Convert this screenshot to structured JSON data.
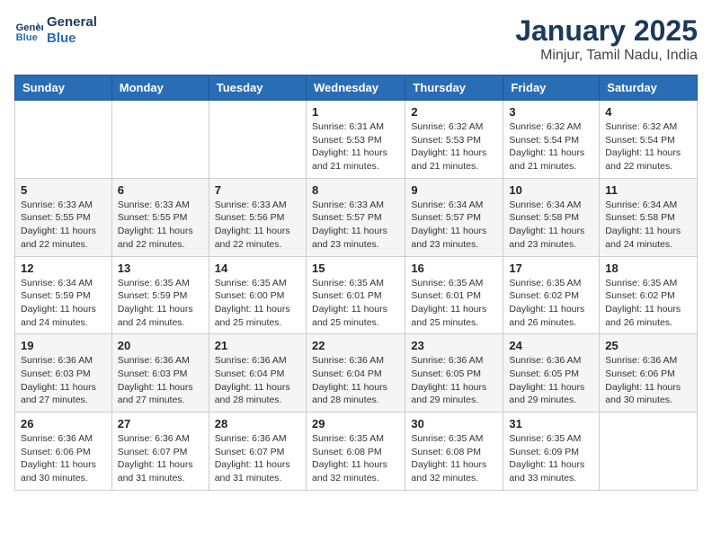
{
  "header": {
    "logo_general": "General",
    "logo_blue": "Blue",
    "month_title": "January 2025",
    "subtitle": "Minjur, Tamil Nadu, India"
  },
  "days_of_week": [
    "Sunday",
    "Monday",
    "Tuesday",
    "Wednesday",
    "Thursday",
    "Friday",
    "Saturday"
  ],
  "weeks": [
    [
      {
        "day": "",
        "info": ""
      },
      {
        "day": "",
        "info": ""
      },
      {
        "day": "",
        "info": ""
      },
      {
        "day": "1",
        "info": "Sunrise: 6:31 AM\nSunset: 5:53 PM\nDaylight: 11 hours and 21 minutes."
      },
      {
        "day": "2",
        "info": "Sunrise: 6:32 AM\nSunset: 5:53 PM\nDaylight: 11 hours and 21 minutes."
      },
      {
        "day": "3",
        "info": "Sunrise: 6:32 AM\nSunset: 5:54 PM\nDaylight: 11 hours and 21 minutes."
      },
      {
        "day": "4",
        "info": "Sunrise: 6:32 AM\nSunset: 5:54 PM\nDaylight: 11 hours and 22 minutes."
      }
    ],
    [
      {
        "day": "5",
        "info": "Sunrise: 6:33 AM\nSunset: 5:55 PM\nDaylight: 11 hours and 22 minutes."
      },
      {
        "day": "6",
        "info": "Sunrise: 6:33 AM\nSunset: 5:55 PM\nDaylight: 11 hours and 22 minutes."
      },
      {
        "day": "7",
        "info": "Sunrise: 6:33 AM\nSunset: 5:56 PM\nDaylight: 11 hours and 22 minutes."
      },
      {
        "day": "8",
        "info": "Sunrise: 6:33 AM\nSunset: 5:57 PM\nDaylight: 11 hours and 23 minutes."
      },
      {
        "day": "9",
        "info": "Sunrise: 6:34 AM\nSunset: 5:57 PM\nDaylight: 11 hours and 23 minutes."
      },
      {
        "day": "10",
        "info": "Sunrise: 6:34 AM\nSunset: 5:58 PM\nDaylight: 11 hours and 23 minutes."
      },
      {
        "day": "11",
        "info": "Sunrise: 6:34 AM\nSunset: 5:58 PM\nDaylight: 11 hours and 24 minutes."
      }
    ],
    [
      {
        "day": "12",
        "info": "Sunrise: 6:34 AM\nSunset: 5:59 PM\nDaylight: 11 hours and 24 minutes."
      },
      {
        "day": "13",
        "info": "Sunrise: 6:35 AM\nSunset: 5:59 PM\nDaylight: 11 hours and 24 minutes."
      },
      {
        "day": "14",
        "info": "Sunrise: 6:35 AM\nSunset: 6:00 PM\nDaylight: 11 hours and 25 minutes."
      },
      {
        "day": "15",
        "info": "Sunrise: 6:35 AM\nSunset: 6:01 PM\nDaylight: 11 hours and 25 minutes."
      },
      {
        "day": "16",
        "info": "Sunrise: 6:35 AM\nSunset: 6:01 PM\nDaylight: 11 hours and 25 minutes."
      },
      {
        "day": "17",
        "info": "Sunrise: 6:35 AM\nSunset: 6:02 PM\nDaylight: 11 hours and 26 minutes."
      },
      {
        "day": "18",
        "info": "Sunrise: 6:35 AM\nSunset: 6:02 PM\nDaylight: 11 hours and 26 minutes."
      }
    ],
    [
      {
        "day": "19",
        "info": "Sunrise: 6:36 AM\nSunset: 6:03 PM\nDaylight: 11 hours and 27 minutes."
      },
      {
        "day": "20",
        "info": "Sunrise: 6:36 AM\nSunset: 6:03 PM\nDaylight: 11 hours and 27 minutes."
      },
      {
        "day": "21",
        "info": "Sunrise: 6:36 AM\nSunset: 6:04 PM\nDaylight: 11 hours and 28 minutes."
      },
      {
        "day": "22",
        "info": "Sunrise: 6:36 AM\nSunset: 6:04 PM\nDaylight: 11 hours and 28 minutes."
      },
      {
        "day": "23",
        "info": "Sunrise: 6:36 AM\nSunset: 6:05 PM\nDaylight: 11 hours and 29 minutes."
      },
      {
        "day": "24",
        "info": "Sunrise: 6:36 AM\nSunset: 6:05 PM\nDaylight: 11 hours and 29 minutes."
      },
      {
        "day": "25",
        "info": "Sunrise: 6:36 AM\nSunset: 6:06 PM\nDaylight: 11 hours and 30 minutes."
      }
    ],
    [
      {
        "day": "26",
        "info": "Sunrise: 6:36 AM\nSunset: 6:06 PM\nDaylight: 11 hours and 30 minutes."
      },
      {
        "day": "27",
        "info": "Sunrise: 6:36 AM\nSunset: 6:07 PM\nDaylight: 11 hours and 31 minutes."
      },
      {
        "day": "28",
        "info": "Sunrise: 6:36 AM\nSunset: 6:07 PM\nDaylight: 11 hours and 31 minutes."
      },
      {
        "day": "29",
        "info": "Sunrise: 6:35 AM\nSunset: 6:08 PM\nDaylight: 11 hours and 32 minutes."
      },
      {
        "day": "30",
        "info": "Sunrise: 6:35 AM\nSunset: 6:08 PM\nDaylight: 11 hours and 32 minutes."
      },
      {
        "day": "31",
        "info": "Sunrise: 6:35 AM\nSunset: 6:09 PM\nDaylight: 11 hours and 33 minutes."
      },
      {
        "day": "",
        "info": ""
      }
    ]
  ]
}
